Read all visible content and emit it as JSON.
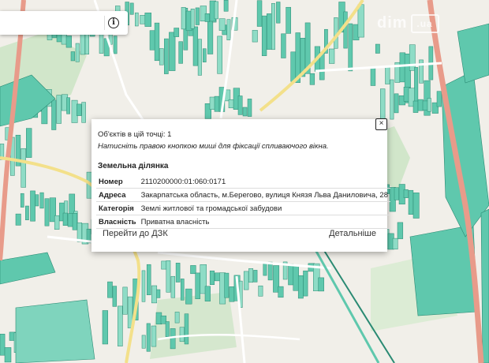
{
  "search": {
    "value": "",
    "placeholder": ""
  },
  "icons": {
    "info": "info-icon",
    "close": "close-icon"
  },
  "toolbar": {
    "info_symbol": "i"
  },
  "watermark": {
    "text": "dim",
    "domain": ".ua"
  },
  "popup": {
    "objects_count": "Об'єктів в цій точці: 1",
    "hint": "Натисніть правою кнопкою миші для фіксації спливаючого вікна.",
    "section_title": "Земельна ділянка",
    "close_symbol": "×",
    "fields": [
      {
        "key": "Номер",
        "value": "2110200000:01:060:0171"
      },
      {
        "key": "Адреса",
        "value": "Закарпатська область, м.Берегово, вулиця Князя Льва Даниловича, 28"
      },
      {
        "key": "Категорія",
        "value": "Землі житлової та громадської забудови"
      },
      {
        "key": "Власність",
        "value": "Приватна власність"
      }
    ],
    "goto_label": "Перейти до ДЗК",
    "details_label": "Детальніше"
  },
  "colors": {
    "parcel_fill": "#5fc8ad",
    "parcel_stroke": "#2a8a73",
    "road_main": "#e89b8a",
    "road_secondary": "#f3e08a",
    "green_area": "#c9e4c2",
    "base": "#f1efe9"
  }
}
